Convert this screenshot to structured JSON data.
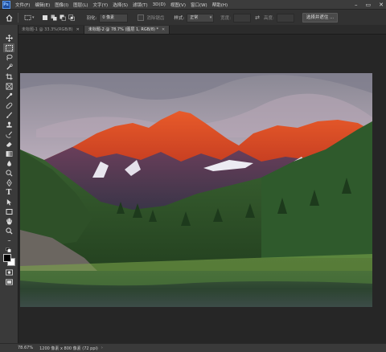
{
  "menubar": {
    "items": [
      "文件(F)",
      "编辑(E)",
      "图像(I)",
      "图层(L)",
      "文字(Y)",
      "选择(S)",
      "滤镜(T)",
      "3D(D)",
      "视图(V)",
      "窗口(W)",
      "帮助(H)"
    ]
  },
  "options": {
    "feather_label": "羽化:",
    "feather_value": "0 像素",
    "antialias_label": "消除锯齿",
    "style_label": "样式:",
    "style_value": "正常",
    "width_label": "宽度:",
    "height_label": "高度:",
    "select_mask_button": "选择并遮住 ..."
  },
  "tabs": [
    {
      "label": "未标题-1 @ 33.3%(RGB/8)"
    },
    {
      "label": "未标题-2 @ 78.7% (图层 1, RGB/8) *"
    }
  ],
  "status": {
    "zoom": "78.67%",
    "doc_info": "1200 像素 x 800 像素 (72 ppi)"
  },
  "colors": {
    "accent": "#1f4fa0",
    "panel": "#3a3a3a",
    "canvas_bg": "#262626"
  }
}
